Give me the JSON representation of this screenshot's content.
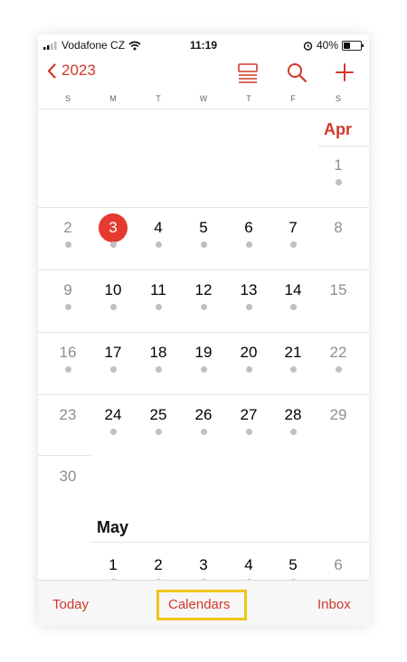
{
  "status": {
    "carrier": "Vodafone CZ",
    "time": "11:19",
    "battery": "40%"
  },
  "nav": {
    "back_label": "2023"
  },
  "weekdays": [
    "S",
    "M",
    "T",
    "W",
    "T",
    "F",
    "S"
  ],
  "april": {
    "label": "Apr",
    "rows": [
      [
        "1"
      ],
      [
        "2",
        "3",
        "4",
        "5",
        "6",
        "7",
        "8"
      ],
      [
        "9",
        "10",
        "11",
        "12",
        "13",
        "14",
        "15"
      ],
      [
        "16",
        "17",
        "18",
        "19",
        "20",
        "21",
        "22"
      ],
      [
        "23",
        "24",
        "25",
        "26",
        "27",
        "28",
        "29"
      ],
      [
        "30"
      ]
    ],
    "today": "3"
  },
  "may": {
    "label": "May",
    "row1": [
      "1",
      "2",
      "3",
      "4",
      "5",
      "6"
    ]
  },
  "tabbar": {
    "today": "Today",
    "calendars": "Calendars",
    "inbox": "Inbox"
  },
  "colors": {
    "accent": "#d0382b",
    "today_circle": "#e53a30",
    "highlight": "#f0c419"
  },
  "icons": [
    "chevron-left-icon",
    "list-view-icon",
    "search-icon",
    "plus-icon",
    "wifi-icon",
    "alarm-icon",
    "battery-icon"
  ]
}
